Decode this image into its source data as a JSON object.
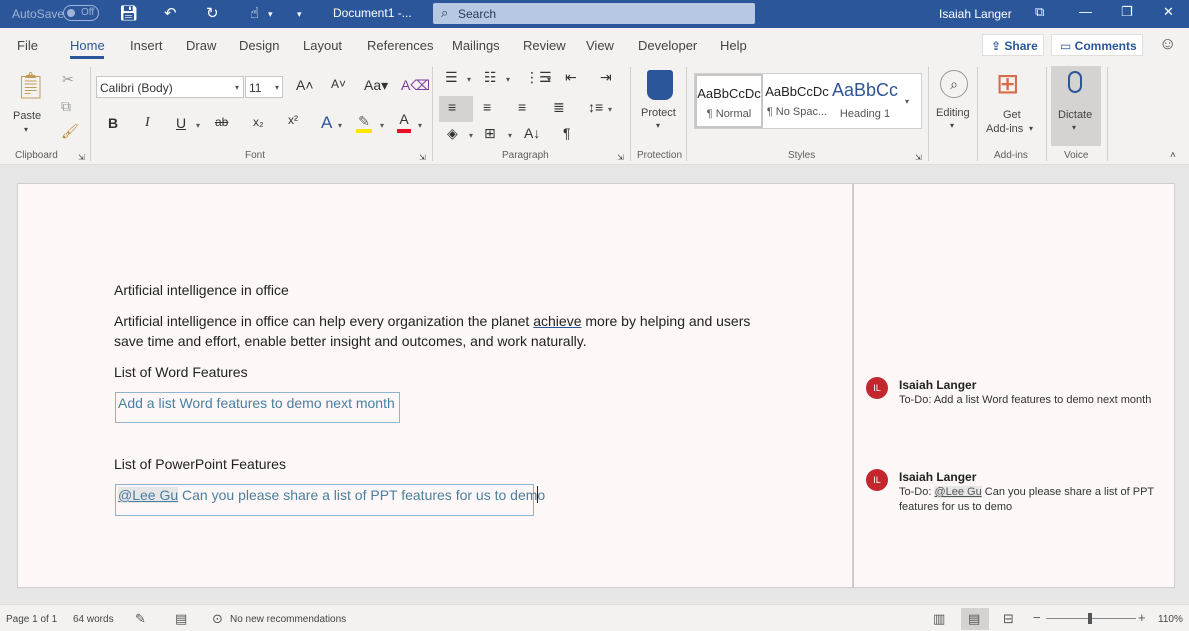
{
  "titlebar": {
    "autosave": "AutoSave",
    "autosave_state": "Off",
    "doc_title": "Document1  -...",
    "search_placeholder": "Search",
    "user": "Isaiah Langer"
  },
  "tabs": [
    "File",
    "Home",
    "Insert",
    "Draw",
    "Design",
    "Layout",
    "References",
    "Mailings",
    "Review",
    "View",
    "Developer",
    "Help"
  ],
  "share": "Share",
  "comments": "Comments",
  "ribbon": {
    "paste": "Paste",
    "font_name": "Calibri (Body)",
    "font_size": "11",
    "protect": "Protect",
    "styles": [
      {
        "preview": "AaBbCcDc",
        "name": "¶ Normal"
      },
      {
        "preview": "AaBbCcDc",
        "name": "¶ No Spac..."
      },
      {
        "preview": "AaBbCc",
        "name": "Heading 1"
      }
    ],
    "editing": "Editing",
    "get_addins_1": "Get",
    "get_addins_2": "Add-ins",
    "dictate": "Dictate",
    "groups": {
      "clipboard": "Clipboard",
      "font": "Font",
      "paragraph": "Paragraph",
      "protection": "Protection",
      "styles": "Styles",
      "addins": "Add-ins",
      "voice": "Voice"
    }
  },
  "document": {
    "heading": "Artificial intelligence in office",
    "para_line1_a": "Artificial intelligence in office can help every organization the planet ",
    "para_line1_b": "achieve",
    "para_line1_c": " more by helping and users",
    "para_line2": "save time and effort, enable better insight and outcomes, and work naturally.",
    "list_word": "List of Word Features",
    "comment1_inline": "Add a list Word features to demo next month",
    "list_ppt": "List of PowerPoint Features",
    "mention_inline": "@Lee Gu",
    "comment2_inline": " Can you please share a list of PPT features for us to demo"
  },
  "comments_pane": [
    {
      "initials": "IL",
      "author": "Isaiah Langer",
      "text": "To-Do: Add a list Word features to demo next month"
    },
    {
      "initials": "IL",
      "author": "Isaiah Langer",
      "prefix": "To-Do: ",
      "mention": "@Lee Gu",
      "text": "  Can you please share a list of PPT features for us to demo"
    }
  ],
  "status": {
    "page": "Page 1 of 1",
    "words": "64 words",
    "recommendations": "No new recommendations",
    "zoom": "110%"
  },
  "colors": {
    "brand": "#2b579a",
    "avatar": "#c4262e"
  }
}
